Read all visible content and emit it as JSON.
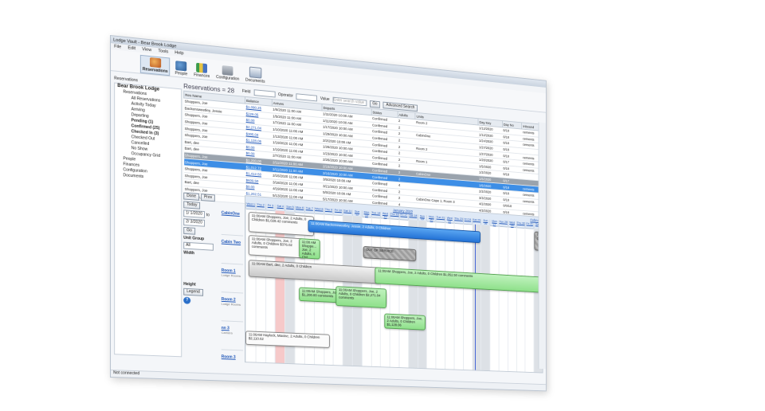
{
  "window": {
    "title": "Lodge Vault - Bear Brook Lodge"
  },
  "menu": [
    "File",
    "Edit",
    "View",
    "Tools",
    "Help"
  ],
  "toolbar": [
    {
      "label": "Reservations",
      "icon": "reservations-icon"
    },
    {
      "label": "People",
      "icon": "people-icon"
    },
    {
      "label": "Finances",
      "icon": "finances-icon"
    },
    {
      "label": "Configuration",
      "icon": "configuration-icon"
    },
    {
      "label": "Documents",
      "icon": "documents-icon"
    }
  ],
  "section_label": "Reservations",
  "tree": {
    "root": "Bear Brook Lodge",
    "reservations": "Reservations",
    "items": [
      "All Reservations",
      "Activity Today",
      "Arriving",
      "Departing",
      "Pending (1)",
      "Confirmed (25)",
      "Checked In (3)",
      "Checked Out",
      "Cancelled",
      "No Show"
    ],
    "occupancy": "Occupancy Grid",
    "people": "People",
    "finances": "Finances",
    "configuration": "Configuration",
    "documents": "Documents"
  },
  "filter": {
    "count_label": "Reservations = 28",
    "field_label": "Field",
    "operator_label": "Operator",
    "value_label": "Value",
    "value_placeholder": "Enter search value",
    "go": "Go",
    "advanced": "Advanced Search"
  },
  "table": {
    "columns": [
      "Res Name",
      "Balance",
      "Arrives",
      "Departs",
      "Status",
      "Adults",
      "Units",
      "Day Key",
      "Day No",
      "Inbound"
    ],
    "rows": [
      [
        "Shoppers, Joe",
        "$1,090.25",
        "1/6/2020 11:00 AM",
        "1/11/2020 10:00 AM",
        "Confirmed",
        "2",
        "Room 2",
        "1/12/2020",
        "0/18",
        "cements"
      ],
      [
        "Backensweetley, Jessie",
        "$229.05",
        "1/5/2020 11:00 AM",
        "1/11/2020 10:00 AM",
        "Confirmed",
        "2",
        "",
        "1/12/2020",
        "0/18",
        "cements"
      ],
      [
        "Shoppers, Joe",
        "$0.00",
        "1/7/2020 11:00 AM",
        "1/17/2020 10:00 AM",
        "Confirmed",
        "2",
        "CabinOne",
        "1/24/2020",
        "0/18",
        "cements"
      ],
      [
        "Shoppers, Joe",
        "$2,271.04",
        "1/10/2020 11:00 AM",
        "1/29/2020 10:00 AM",
        "Confirmed",
        "2",
        "",
        "1/27/2020",
        "0/18",
        ""
      ],
      [
        "Shoppers, Joe",
        "$305.04",
        "1/13/2020 11:00 AM",
        "2/2/2020 10:00 AM",
        "Confirmed",
        "2",
        "Room 2",
        "1/27/2020",
        "0/18",
        "cements"
      ],
      [
        "Shoppers, Joe",
        "$1,128.06",
        "1/19/2020 11:00 AM",
        "1/26/2020 10:00 AM",
        "Confirmed",
        "2",
        "",
        "1/28/2020",
        "0/17",
        "cements"
      ],
      [
        "Bart, dee",
        "$0.00",
        "1/19/2020 11:00 AM",
        "1/23/2020 10:00 AM",
        "Confirmed",
        "2",
        "Room 1",
        "1/5/2020",
        "0/18",
        "cements"
      ],
      [
        "Bart, dee",
        "$0.00",
        "2/7/2020 11:00 AM",
        "2/26/2020 10:00 AM",
        "Confirmed",
        "2",
        "",
        "1/2/2020",
        "0/18",
        ""
      ],
      [
        "Shoppers, Joe",
        "$1,200.00",
        "2/11/2020 11:00 AM",
        "2/15/2020 10:00 AM",
        "Confirmed",
        "2",
        "CabinOne",
        "1/6/2020",
        "0/17",
        ""
      ],
      [
        "Shoppers, Joe",
        "$1,012.72",
        "2/11/2020 11:00 AM",
        "2/16/2020 10:00 AM",
        "Confirmed",
        "2",
        "",
        "1/6/2020",
        "0/18",
        "cements"
      ],
      [
        "Shoppers, Joe",
        "$1,412.50",
        "2/15/2020 11:00 AM",
        "3/5/2020 10:00 AM",
        "Confirmed",
        "4",
        "",
        "2/2/2020",
        "0/18",
        "cements"
      ],
      [
        "Shoppers, Joe",
        "$609.50",
        "3/18/2020 11:00 AM",
        "3/21/2020 10:00 AM",
        "Confirmed",
        "2",
        "",
        "3/3/2020",
        "0/18",
        "cements"
      ],
      [
        "Bart, dee",
        "$0.00",
        "4/19/2020 11:00 AM",
        "5/5/2020 10:00 AM",
        "Confirmed",
        "2",
        "CabinOne Cape 1, Room 3",
        "4/2/2020",
        "0/0/18",
        ""
      ],
      [
        "Shoppers, Joe",
        "$1,202.51",
        "5/13/2020 11:00 AM",
        "5/17/2020 10:00 AM",
        "Confirmed",
        "4",
        "",
        "4/3/2020",
        "0/18",
        "cements"
      ],
      [
        "Shoppers, Joe",
        "$1,412.50",
        "5/14/2020 11:00 AM",
        "5/16/2020 10:00 AM",
        "Confirmed",
        "4",
        "",
        "4/3/2020",
        "0/18",
        "cements"
      ]
    ]
  },
  "schedule": {
    "done": "Done",
    "prev": "Prev",
    "today": "Today",
    "from_date": "1/ 1/2020",
    "to_label": "to",
    "to_date": "2/ 3/2020",
    "go": "Go",
    "unit_group_label": "Unit Group",
    "unit_group_value": "All",
    "width_label": "Width",
    "height_label": "Height",
    "legend": "Legend",
    "header_link": "January 2020",
    "header_link_right": "Februar",
    "days": [
      "Wed 1",
      "Thu 2",
      "Fri 3",
      "Sat 4",
      "Sun 5",
      "Mon 6",
      "Tue 7",
      "Wed 8",
      "Thu 9",
      "Fri 10",
      "Sat 11",
      "Sun 12",
      "Mon 13",
      "Tue 14",
      "Wed 15",
      "Thu 16",
      "Fri 17",
      "Sat 18",
      "Sun 19",
      "Mon 20",
      "Tue 21",
      "Wed 22",
      "Thu 23",
      "Fri 24",
      "Sat 25",
      "Sun 26",
      "Mon 27",
      "Tue 28",
      "Wed 29",
      "Thu 30",
      "Fri 31",
      "Sat 1"
    ],
    "rooms": [
      {
        "name": "CabinOne",
        "type": ""
      },
      {
        "name": "Cabin Two",
        "type": ""
      },
      {
        "name": "Room 1",
        "type": "Lodge Rooms"
      },
      {
        "name": "Room 2",
        "type": "Lodge Rooms"
      },
      {
        "name": "nn 3",
        "type": "Camera"
      },
      {
        "name": "Room 3",
        "type": ""
      }
    ],
    "bookings": [
      {
        "text": "11:00AM Shoppers, Joe, 2 Adults, 0 Children $1,028.42 comments",
        "style": "white"
      },
      {
        "text": "11:00AM Backensweetley, Jessie, 2 Adults, 0 Children",
        "style": "blue"
      },
      {
        "text": "OUT OF SERVICE",
        "style": "oos"
      },
      {
        "text": "OUT OF",
        "style": "oos"
      },
      {
        "text": "11:00AM Shoppers, Joe, 2 Adults, 0 Children $376.02 comments",
        "style": "white"
      },
      {
        "text": "11:00 AM Shoppe... Joe, 2 Adults, 0 Chil...",
        "style": "green"
      },
      {
        "text": "11:00AM Bart, dee, 2 Adults, 0 Children",
        "style": "gray"
      },
      {
        "text": "11:00AM Shoppers, Joe, 2 Adults, 0 Children $1,052.50 comments",
        "style": "green"
      },
      {
        "text": "11:00AM Shoppers, Joe, 2 Adults, 0 Children $1,200.00 comments",
        "style": "green"
      },
      {
        "text": "11:00AM Shoppers, Joe, 2 Adults, 0 Children $2,271.04 comments",
        "style": "green"
      },
      {
        "text": "11:00AM Shoppers, Joe, 2 Adults, 0 Children $1,128.06",
        "style": "green"
      },
      {
        "text": "11:00AM Haylock, Maxine, 2 Adults, 0 Children $2,110.62",
        "style": "white"
      }
    ]
  },
  "status_bar": "Not connected"
}
